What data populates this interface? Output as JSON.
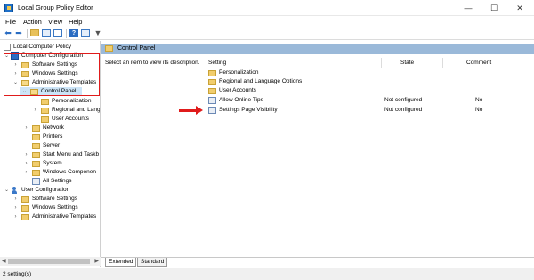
{
  "window": {
    "title": "Local Group Policy Editor",
    "minimize": "—",
    "maximize": "☐",
    "close": "✕"
  },
  "menu": [
    "File",
    "Action",
    "View",
    "Help"
  ],
  "toolbar": {
    "back": "⬅",
    "forward": "➡",
    "filter": "▼"
  },
  "tree": {
    "root": "Local Computer Policy",
    "computer_configuration": "Computer Configuration",
    "software_settings": "Software Settings",
    "windows_settings": "Windows Settings",
    "administrative_templates": "Administrative Templates",
    "control_panel": "Control Panel",
    "personalization": "Personalization",
    "regional_and_language": "Regional and Lang",
    "user_accounts": "User Accounts",
    "network": "Network",
    "printers": "Printers",
    "server": "Server",
    "start_menu": "Start Menu and Taskb",
    "system": "System",
    "windows_components": "Windows Componen",
    "all_settings": "All Settings",
    "user_configuration": "User Configuration",
    "user_software_settings": "Software Settings",
    "user_windows_settings": "Windows Settings",
    "user_administrative_templates": "Administrative Templates"
  },
  "right_pane": {
    "header": "Control Panel",
    "description": "Select an item to view its description.",
    "columns": {
      "setting": "Setting",
      "state": "State",
      "comment": "Comment"
    },
    "rows": [
      {
        "name": "Personalization",
        "state": "",
        "comment": ""
      },
      {
        "name": "Regional and Language Options",
        "state": "",
        "comment": ""
      },
      {
        "name": "User Accounts",
        "state": "",
        "comment": ""
      },
      {
        "name": "Allow Online Tips",
        "state": "Not configured",
        "comment": "No"
      },
      {
        "name": "Settings Page Visibility",
        "state": "Not configured",
        "comment": "No"
      }
    ]
  },
  "tabs": {
    "extended": "Extended",
    "standard": "Standard"
  },
  "status": {
    "text": "2 setting(s)"
  },
  "colors": {
    "highlight": "#e01b1b",
    "header_band": "#9ab9d9",
    "selection": "#cce4f7"
  }
}
